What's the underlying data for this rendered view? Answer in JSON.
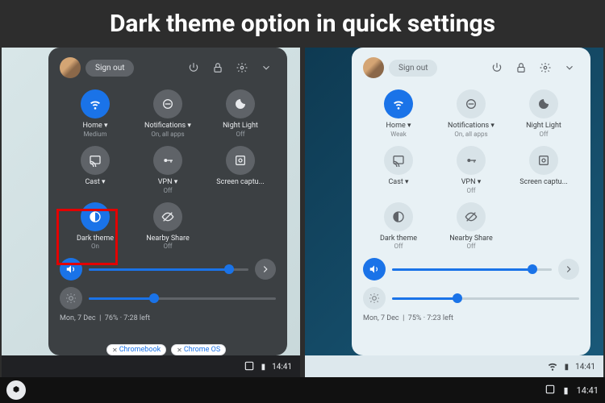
{
  "title": "Dark theme option in quick settings",
  "d": {
    "signout": "Sign out",
    "tiles": [
      {
        "n": "wifi",
        "l": "Home ▾",
        "s": "Medium",
        "on": true
      },
      {
        "n": "notif",
        "l": "Notifications ▾",
        "s": "On, all apps"
      },
      {
        "n": "night",
        "l": "Night Light",
        "s": "Off"
      },
      {
        "n": "cast",
        "l": "Cast ▾",
        "s": ""
      },
      {
        "n": "vpn",
        "l": "VPN ▾",
        "s": "Off"
      },
      {
        "n": "capture",
        "l": "Screen captu...",
        "s": ""
      },
      {
        "n": "dark",
        "l": "Dark theme",
        "s": "On",
        "on": true
      },
      {
        "n": "nearby",
        "l": "Nearby Share",
        "s": "Off"
      }
    ],
    "vol": 88,
    "bright": 35,
    "date": "Mon, 7 Dec",
    "batt": "76% · 7:28 left",
    "time": "14:41"
  },
  "l": {
    "signout": "Sign out",
    "tiles": [
      {
        "n": "wifi",
        "l": "Home ▾",
        "s": "Weak",
        "on": true
      },
      {
        "n": "notif",
        "l": "Notifications ▾",
        "s": "On, all apps"
      },
      {
        "n": "night",
        "l": "Night Light",
        "s": "Off"
      },
      {
        "n": "cast",
        "l": "Cast ▾",
        "s": ""
      },
      {
        "n": "vpn",
        "l": "VPN ▾",
        "s": "Off"
      },
      {
        "n": "capture",
        "l": "Screen captu...",
        "s": ""
      },
      {
        "n": "dark",
        "l": "Dark theme",
        "s": "Off"
      },
      {
        "n": "nearby",
        "l": "Nearby Share",
        "s": "Off"
      }
    ],
    "vol": 88,
    "bright": 35,
    "date": "Mon, 7 Dec",
    "batt": "75% · 7:23 left",
    "time": "14:41"
  },
  "tags": [
    "Chromebook",
    "Chrome OS"
  ],
  "shelftime": "14:41"
}
